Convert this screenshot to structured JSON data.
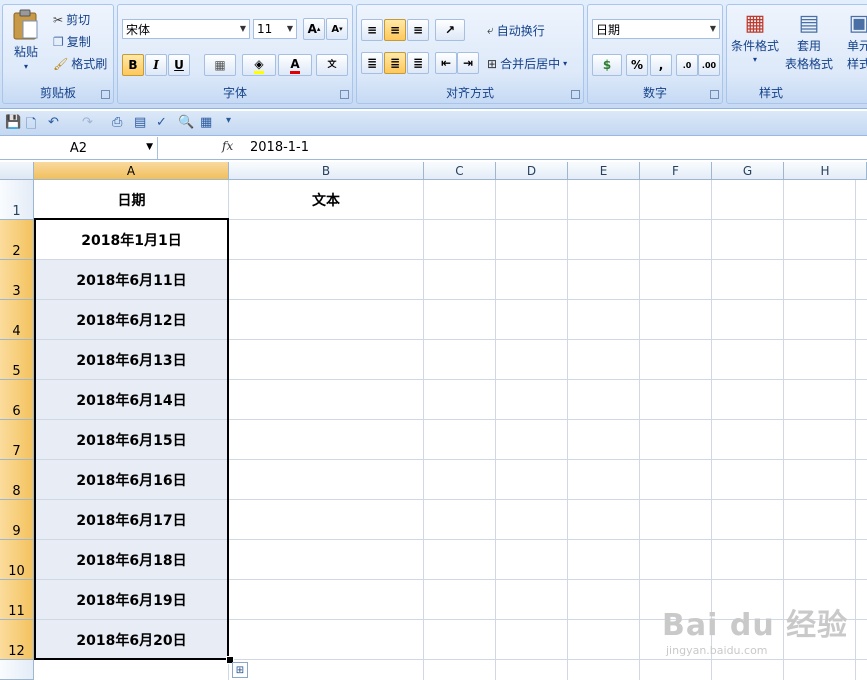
{
  "ribbon": {
    "clipboard": {
      "paste": "粘贴",
      "cut": "剪切",
      "copy": "复制",
      "format_painter": "格式刷",
      "label": "剪贴板"
    },
    "font": {
      "name": "宋体",
      "size": "11",
      "label": "字体",
      "bold": "B",
      "italic": "I",
      "underline": "U",
      "color_letter": "A",
      "phonetic": "wén\n文"
    },
    "alignment": {
      "wrap_text": "自动换行",
      "merge_center": "合并后居中",
      "label": "对齐方式"
    },
    "number": {
      "format": "日期",
      "percent": "%",
      "comma": ",",
      "label": "数字"
    },
    "styles": {
      "conditional": "条件格式",
      "table_fmt_1": "套用",
      "table_fmt_2": "表格格式",
      "cell_styles_1": "单元",
      "cell_styles_2": "样式",
      "label": "样式"
    }
  },
  "formula_bar": {
    "name_box": "A2",
    "fx": "fx",
    "value": "2018-1-1"
  },
  "columns": [
    "A",
    "B",
    "C",
    "D",
    "E",
    "F",
    "G",
    "H"
  ],
  "rows": [
    "1",
    "2",
    "3",
    "4",
    "5",
    "6",
    "7",
    "8",
    "9",
    "10",
    "11",
    "12"
  ],
  "header_row": {
    "a": "日期",
    "b": "文本"
  },
  "cells": [
    "2018年1月1日",
    "2018年6月11日",
    "2018年6月12日",
    "2018年6月13日",
    "2018年6月14日",
    "2018年6月15日",
    "2018年6月16日",
    "2018年6月17日",
    "2018年6月18日",
    "2018年6月19日",
    "2018年6月20日"
  ],
  "watermark": {
    "logo": "Bai du 经验",
    "url": "jingyan.baidu.com"
  },
  "colors": {
    "selection_fill": "#e8ecf4",
    "header_selected": "#f1c05c",
    "ribbon_bg": "#dbe8f8"
  }
}
